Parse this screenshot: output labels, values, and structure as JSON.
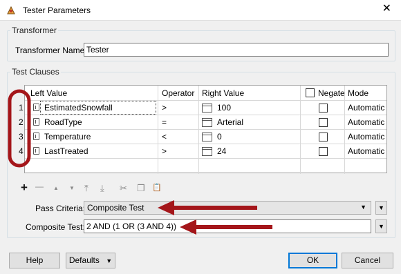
{
  "window": {
    "title": "Tester Parameters",
    "close_glyph": "✕"
  },
  "transformer": {
    "group_label": "Transformer",
    "name_label": "Transformer Name:",
    "name_value": "Tester"
  },
  "test_clauses": {
    "group_label": "Test Clauses",
    "columns": [
      "Left Value",
      "Operator",
      "Right Value",
      "Negate",
      "Mode"
    ],
    "rows": [
      {
        "num": "1",
        "left": "EstimatedSnowfall",
        "operator": ">",
        "right": "100",
        "mode": "Automatic",
        "negate": false
      },
      {
        "num": "2",
        "left": "RoadType",
        "operator": "=",
        "right": "Arterial",
        "mode": "Automatic",
        "negate": false
      },
      {
        "num": "3",
        "left": "Temperature",
        "operator": "<",
        "right": "0",
        "mode": "Automatic",
        "negate": false
      },
      {
        "num": "4",
        "left": "LastTreated",
        "operator": ">",
        "right": "24",
        "mode": "Automatic",
        "negate": false
      }
    ]
  },
  "toolbar": {
    "add": "+",
    "remove": "—",
    "move_up": "▲",
    "move_down": "▼",
    "move_top": "⤒",
    "move_bottom": "⤓",
    "cut": "✂",
    "copy": "❐",
    "paste": "📋"
  },
  "criteria": {
    "pass_label": "Pass Criteria:",
    "pass_value": "Composite Test",
    "composite_label": "Composite Test:",
    "composite_value": "2 AND (1 OR (3 AND 4))"
  },
  "buttons": {
    "help": "Help",
    "defaults": "Defaults",
    "ok": "OK",
    "cancel": "Cancel"
  },
  "colors": {
    "annotation": "#a4161a",
    "ok_border": "#0078d7"
  }
}
